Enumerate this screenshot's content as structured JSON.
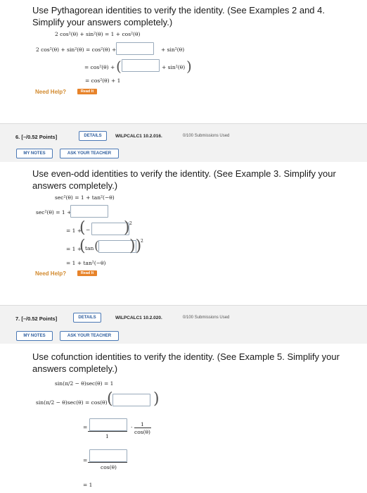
{
  "q5": {
    "prompt": "Use Pythagorean identities to verify the identity. (See Examples 2 and 4. Simplify your answers completely.)",
    "identity": "2 cos²(θ) + sin²(θ) = 1 + cos²(θ)",
    "step1_lhs": "2 cos²(θ) + sin²(θ) = cos²(θ) +",
    "step1_rhs": "+ sin²(θ)",
    "step2_lhs": "= cos²(θ) +",
    "step2_rhs": "+ sin²(θ)",
    "step3": "= cos²(θ) + 1",
    "need_help": "Need Help?",
    "read_it": "Read It"
  },
  "q6": {
    "number": "6. [–/0.52 Points]",
    "details": "DETAILS",
    "course": "WILPCALC1 10.2.016.",
    "submissions": "0/100 Submissions Used",
    "my_notes": "MY NOTES",
    "ask_teacher": "ASK YOUR TEACHER",
    "prompt": "Use even-odd identities to verify the identity. (See Example 3. Simplify your answers completely.)",
    "identity": "sec²(θ) = 1 + tan²(−θ)",
    "step1": "sec²(θ) = 1 +",
    "step2": "= 1 +",
    "step3": "= 1 +",
    "step4": "= 1 + tan²(−θ)",
    "minus": "−",
    "tan_open": "tan",
    "need_help": "Need Help?",
    "read_it": "Read It"
  },
  "q7": {
    "number": "7. [–/0.52 Points]",
    "details": "DETAILS",
    "course": "WILPCALC1 10.2.020.",
    "submissions": "0/100 Submissions Used",
    "my_notes": "MY NOTES",
    "ask_teacher": "ASK YOUR TEACHER",
    "prompt": "Use cofunction identities to verify the identity. (See Example 5. Simplify your answers completely.)",
    "identity": "sin(π/2 − θ)sec(θ) = 1",
    "step1": "sin(π/2 − θ)sec(θ) = cos(θ) ·",
    "step2_eq": "=",
    "step2_den": "1",
    "step2_dot": "·",
    "step2_frac_num": "1",
    "step2_frac_den": "cos(θ)",
    "step3_eq": "=",
    "step3_den": "cos(θ)",
    "step4": "= 1"
  }
}
